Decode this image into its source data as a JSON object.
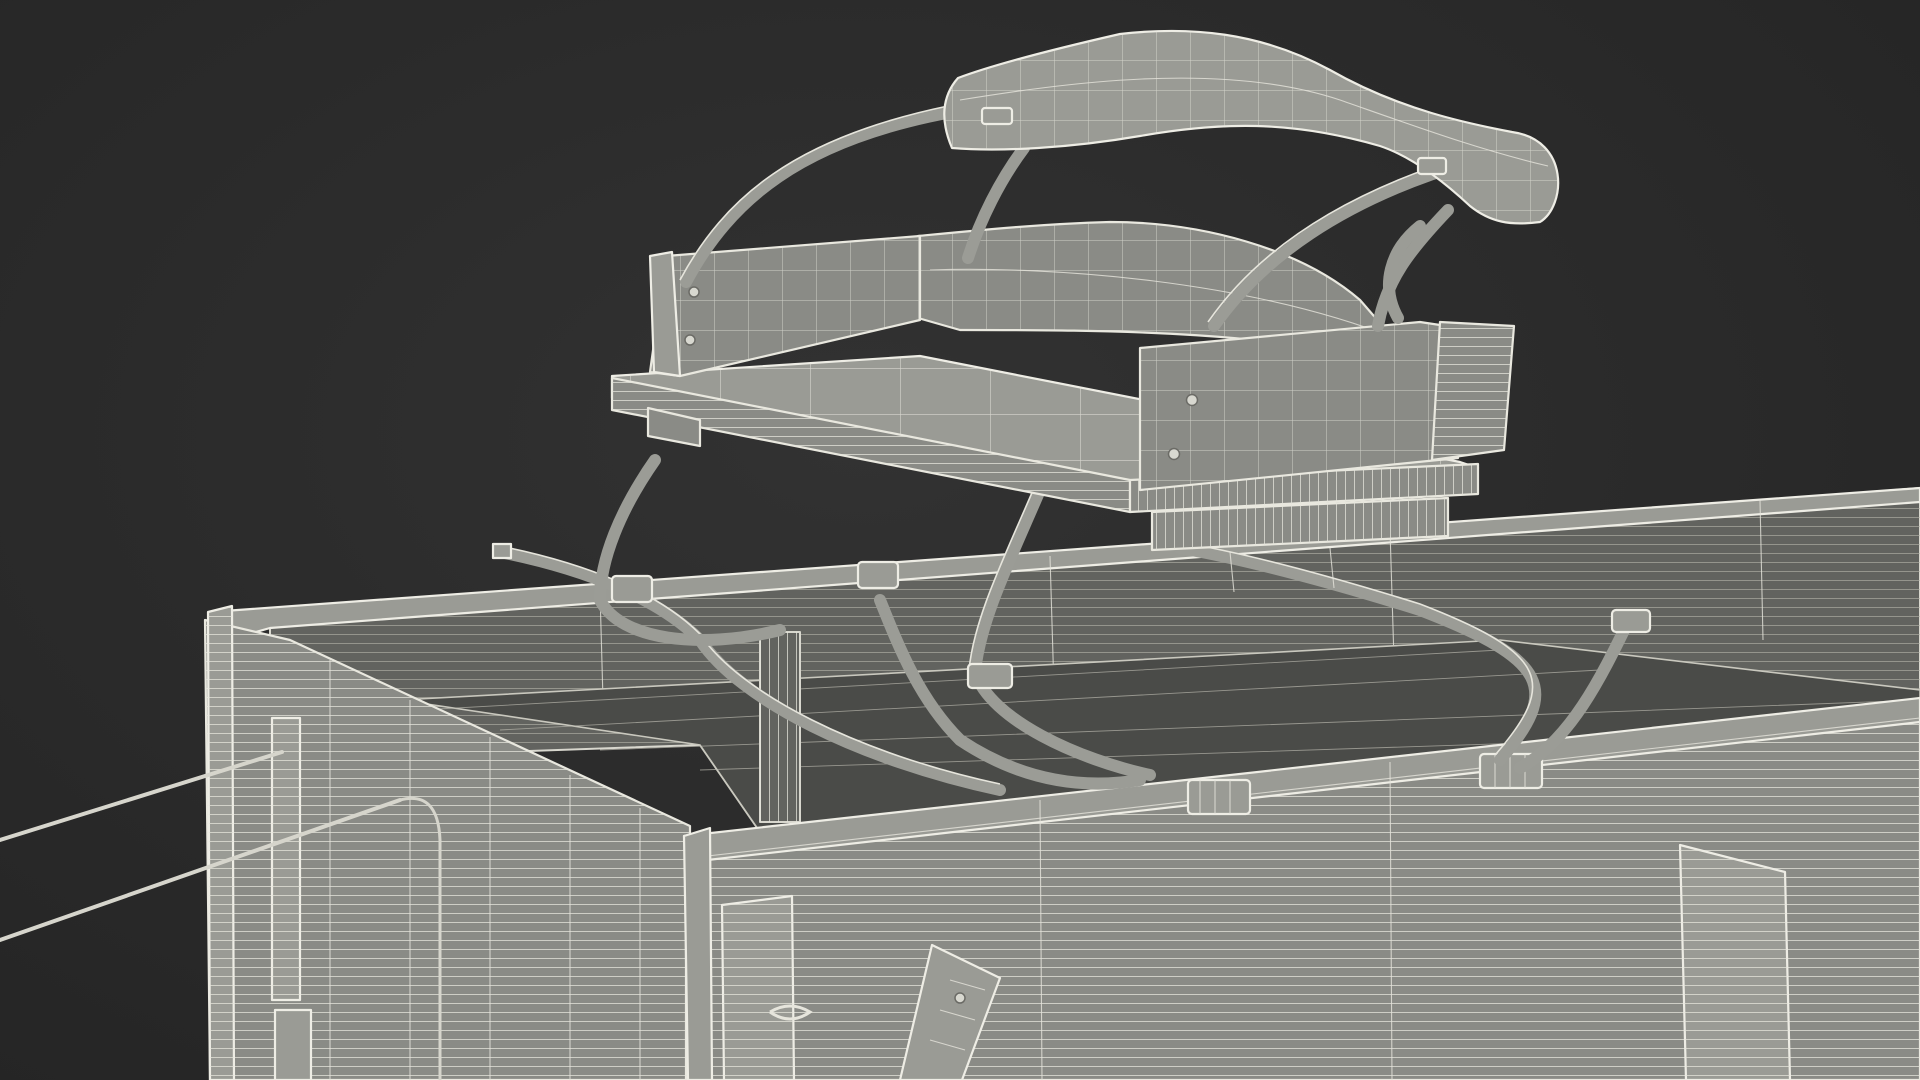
{
  "scene": {
    "subject": "wagon-box-with-spring-seat",
    "render_style": "wireframe-over-clay",
    "background_color": "#2a2a2a",
    "material_color": "#8a8b86",
    "wire_color": "#e9e8df"
  }
}
